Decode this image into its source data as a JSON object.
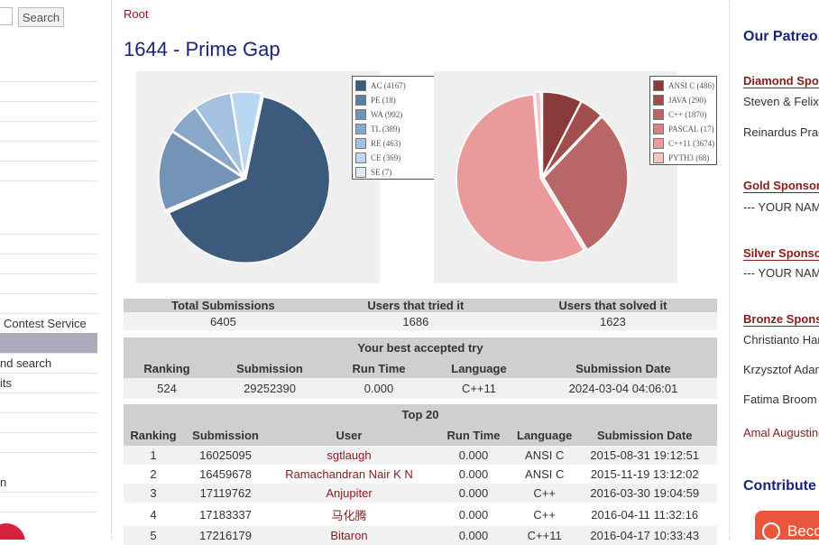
{
  "left": {
    "search_label": "Search",
    "items": [
      "Contest Service",
      "nd search",
      "its",
      "n"
    ]
  },
  "main": {
    "breadcrumb": "Root",
    "title": "1644 - Prime Gap"
  },
  "chart_data": [
    {
      "type": "pie",
      "legend": [
        "AC (4167)",
        "PE (18)",
        "WA (992)",
        "TL (389)",
        "RE (463)",
        "CE (369)",
        "SE (7)"
      ],
      "values": [
        4167,
        18,
        992,
        389,
        463,
        369,
        7
      ],
      "colors": [
        "#3c5a7b",
        "#5d7fa2",
        "#7393b7",
        "#89a7c9",
        "#a5c2e0",
        "#b9d6f2",
        "#dcecfa"
      ]
    },
    {
      "type": "pie",
      "legend": [
        "ANSI C (486)",
        "JAVA (290)",
        "C++ (1870)",
        "PASCAL (17)",
        "C++11 (3674)",
        "PYTH3 (68)"
      ],
      "values": [
        486,
        290,
        1870,
        17,
        3674,
        68
      ],
      "colors": [
        "#8b3a3a",
        "#a24e4e",
        "#b96666",
        "#d38484",
        "#ea9a9a",
        "#f7c2c2"
      ]
    }
  ],
  "stats": {
    "headers": [
      "Total Submissions",
      "Users that tried it",
      "Users that solved it"
    ],
    "values": [
      "6405",
      "1686",
      "1623"
    ]
  },
  "best": {
    "title": "Your best accepted try",
    "headers": [
      "Ranking",
      "Submission",
      "Run Time",
      "Language",
      "Submission Date"
    ],
    "row": [
      "524",
      "29252390",
      "0.000",
      "C++11",
      "2024-03-04 04:06:01"
    ]
  },
  "top": {
    "title": "Top 20",
    "headers": [
      "Ranking",
      "Submission",
      "User",
      "Run Time",
      "Language",
      "Submission Date"
    ],
    "rows": [
      [
        "1",
        "16025095",
        "sgtlaugh",
        "0.000",
        "ANSI C",
        "2015-08-31 19:12:51"
      ],
      [
        "2",
        "16459678",
        "Ramachandran Nair K N",
        "0.000",
        "ANSI C",
        "2015-11-19 13:12:02"
      ],
      [
        "3",
        "17119762",
        "Anjupiter",
        "0.000",
        "C++",
        "2016-03-30 19:04:59"
      ],
      [
        "4",
        "17183337",
        "马化腾",
        "0.000",
        "C++",
        "2016-04-11 11:32:16"
      ],
      [
        "5",
        "17216179",
        "Bitaron",
        "0.000",
        "C++11",
        "2016-04-17 10:33:43"
      ]
    ]
  },
  "right": {
    "heading": "Our Patreon",
    "tiers": [
      {
        "name": "Diamond Sponsors",
        "entries": [
          "Steven & Felix",
          "Reinardus Pradhitya"
        ],
        "link": ""
      },
      {
        "name": "Gold Sponsors",
        "entries": [
          "--- YOUR NAME HERE ---"
        ],
        "link": ""
      },
      {
        "name": "Silver Sponsors",
        "entries": [
          "--- YOUR NAME HERE ---"
        ],
        "link": ""
      },
      {
        "name": "Bronze Sponsors",
        "entries": [
          "Christianto Handojo",
          "Krzysztof Adamek",
          "Fatima Broom"
        ],
        "link": "Amal Augustine"
      }
    ],
    "contribute": "Contribute",
    "patreon_button": "Become a Patron"
  }
}
